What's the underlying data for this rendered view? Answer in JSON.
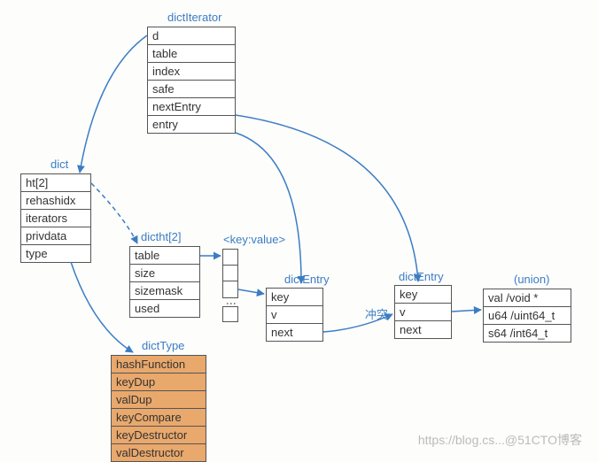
{
  "titles": {
    "dictIterator": "dictIterator",
    "dict": "dict",
    "dictht": "dictht[2]",
    "keyvalue": "<key:value>",
    "dictEntry1": "dictEntry",
    "dictEntry2": "dictEntry",
    "union": "(union)",
    "dictType": "dictType",
    "conflict": "冲突"
  },
  "dictIterator": [
    "d",
    "table",
    "index",
    "safe",
    "nextEntry",
    "entry"
  ],
  "dict": [
    "ht[2]",
    "rehashidx",
    "iterators",
    "privdata",
    "type"
  ],
  "dictht": [
    "table",
    "size",
    "sizemask",
    "used"
  ],
  "dictEntry1": [
    "key",
    "v",
    "next"
  ],
  "dictEntry2": [
    "key",
    "v",
    "next"
  ],
  "union": [
    "val /void *",
    "u64 /uint64_t",
    "s64 /int64_t"
  ],
  "dictType": [
    "hashFunction",
    "keyDup",
    "valDup",
    "keyCompare",
    "keyDestructor",
    "valDestructor"
  ],
  "watermark": "https://blog.cs...@51CTO博客"
}
